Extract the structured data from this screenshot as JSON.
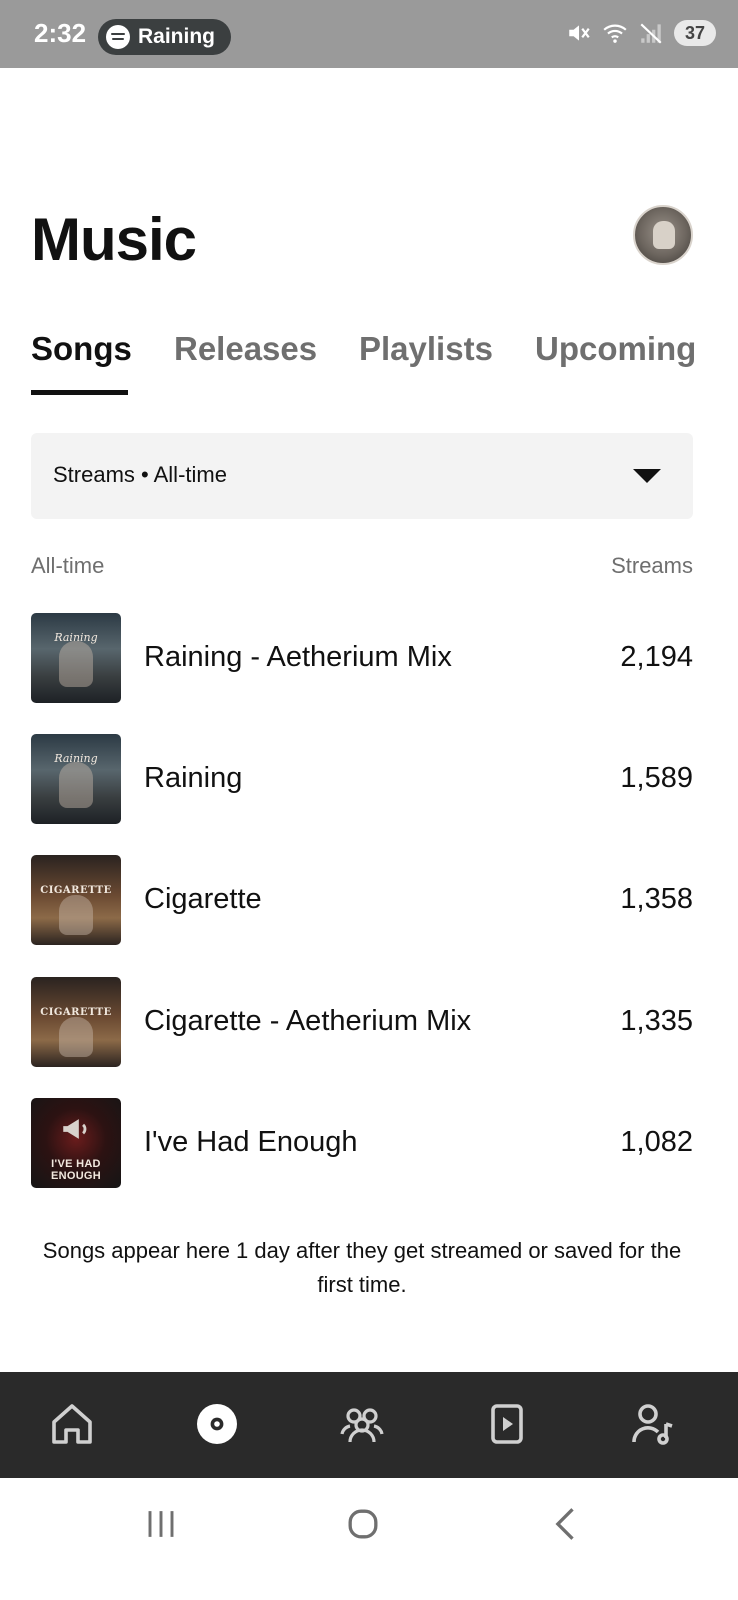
{
  "status_bar": {
    "time": "2:32",
    "now_playing": "Raining",
    "battery": "37",
    "icons": [
      "spotify-icon",
      "mute-icon",
      "wifi-icon",
      "signal-icon"
    ]
  },
  "header": {
    "title": "Music",
    "avatar_icon": "artist-avatar"
  },
  "tabs": [
    {
      "label": "Songs",
      "active": true
    },
    {
      "label": "Releases",
      "active": false
    },
    {
      "label": "Playlists",
      "active": false
    },
    {
      "label": "Upcoming",
      "active": false
    }
  ],
  "filter": {
    "label": "Streams • All-time",
    "icon": "caret-down-icon"
  },
  "list_header": {
    "left": "All-time",
    "right": "Streams"
  },
  "songs": [
    {
      "title": "Raining - Aetherium Mix",
      "streams": "2,194",
      "art": "raining"
    },
    {
      "title": "Raining",
      "streams": "1,589",
      "art": "raining"
    },
    {
      "title": "Cigarette",
      "streams": "1,358",
      "art": "cigarette"
    },
    {
      "title": "Cigarette - Aetherium Mix",
      "streams": "1,335",
      "art": "cigarette"
    },
    {
      "title": "I've Had Enough",
      "streams": "1,082",
      "art": "enough"
    }
  ],
  "art_text": {
    "raining": "Raining",
    "cigarette": "CIGARETTE",
    "enough": "I'VE HAD ENOUGH"
  },
  "note": "Songs appear here 1 day after they get streamed or saved for the first time.",
  "bottom_nav": {
    "items": [
      "home-icon",
      "music-icon",
      "audience-icon",
      "campaigns-icon",
      "profile-icon"
    ],
    "active": "music-icon"
  },
  "system_nav": [
    "recents-icon",
    "home-icon",
    "back-icon"
  ],
  "colors": {
    "status_bar": "#9a9a9a",
    "bottom_nav": "#2a2a2a",
    "tab_inactive": "#6f6f6f",
    "filter_bg": "#f3f3f3"
  }
}
